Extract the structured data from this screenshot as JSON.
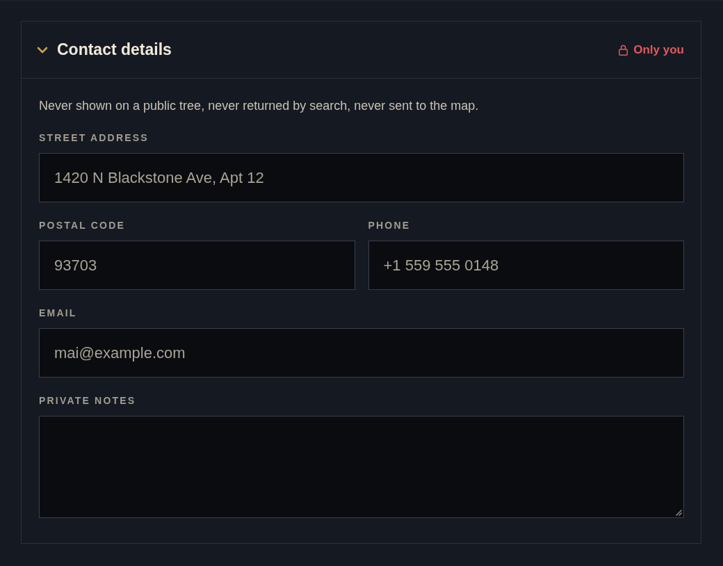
{
  "section": {
    "title": "Contact details",
    "expanded": true,
    "visibility": {
      "kind": "private",
      "label": "Only you"
    }
  },
  "description": "Never shown on a public tree, never returned by search, never sent to the map.",
  "rows": [
    [
      {
        "label": "STREET ADDRESS",
        "kind": "text",
        "value": "1420 N Blackstone Ave, Apt 12"
      }
    ],
    [
      {
        "label": "POSTAL CODE",
        "kind": "text",
        "value": "93703"
      },
      {
        "label": "PHONE",
        "kind": "text",
        "value": "+1 559 555 0148"
      }
    ],
    [
      {
        "label": "EMAIL",
        "kind": "text",
        "value": "mai@example.com"
      }
    ],
    [
      {
        "label": "PRIVATE NOTES",
        "kind": "textarea"
      }
    ]
  ]
}
